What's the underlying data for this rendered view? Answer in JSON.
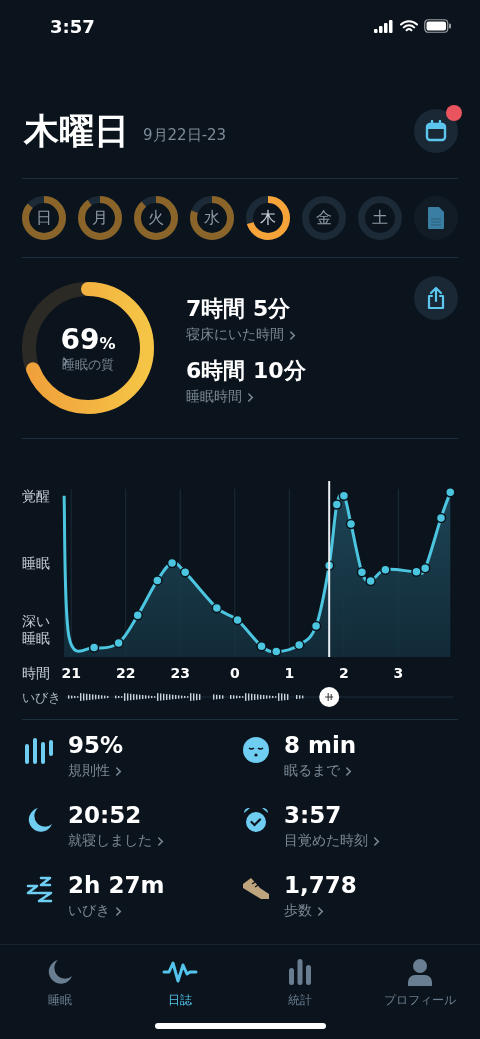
{
  "status_bar": {
    "time": "3:57"
  },
  "header": {
    "title": "木曜日",
    "date_range": "9月22日-23",
    "calendar_badge": true
  },
  "days": [
    {
      "label": "日",
      "selected": false
    },
    {
      "label": "月",
      "selected": false
    },
    {
      "label": "火",
      "selected": false
    },
    {
      "label": "水",
      "selected": false
    },
    {
      "label": "木",
      "selected": true
    },
    {
      "label": "金",
      "selected": false
    },
    {
      "label": "土",
      "selected": false
    }
  ],
  "summary": {
    "quality": {
      "level": 0.69,
      "value": "69",
      "unit": "%",
      "label": "睡眠の質"
    },
    "stats": [
      {
        "value": "7時間 5分",
        "label": "寝床にいた時間"
      },
      {
        "value": "6時間 10分",
        "label": "睡眠時間"
      }
    ]
  },
  "chart": {
    "y_labels": [
      "覚醒",
      "睡眠",
      "深い睡眠"
    ],
    "x_title": "時間",
    "x_labels": [
      "21",
      "22",
      "23",
      "0",
      "1",
      "2",
      "3"
    ],
    "snore_label": "いびき"
  },
  "metrics": [
    {
      "kind": "regularity",
      "value": "95%",
      "label": "規則性"
    },
    {
      "kind": "face",
      "value": "8 min",
      "label": "眠るまで"
    },
    {
      "kind": "moon",
      "value": "20:52",
      "label": "就寝しました"
    },
    {
      "kind": "alarm",
      "value": "3:57",
      "label": "目覚めた時刻"
    },
    {
      "kind": "snore",
      "value": "2h 27m",
      "label": "いびき"
    },
    {
      "kind": "shoe",
      "value": "1,778",
      "label": "歩数"
    }
  ],
  "tab_bar": [
    {
      "kind": "moon",
      "label": "睡眠",
      "selected": false
    },
    {
      "kind": "wave",
      "label": "日誌",
      "selected": true
    },
    {
      "kind": "bars",
      "label": "統計",
      "selected": false
    },
    {
      "kind": "person",
      "label": "プロフィール",
      "selected": false
    }
  ]
}
